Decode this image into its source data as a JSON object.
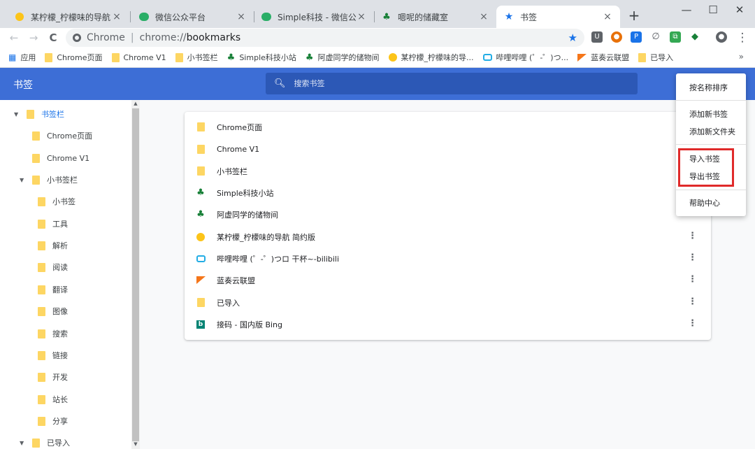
{
  "tabs": [
    {
      "title": "某柠檬_柠檬味的导航 简约",
      "close": "×",
      "icon": "lemon-icon"
    },
    {
      "title": "微信公众平台",
      "close": "×",
      "icon": "wechat-icon"
    },
    {
      "title": "Simple科技 - 微信公众平",
      "close": "×",
      "icon": "wechat-icon"
    },
    {
      "title": "嗯呢的储藏室",
      "close": "×",
      "icon": "tree-icon"
    },
    {
      "title": "书签",
      "close": "×",
      "icon": "star-icon"
    }
  ],
  "newtab": "+",
  "window": {
    "min": "—",
    "max": "☐",
    "close": "✕"
  },
  "toolbar": {
    "back": "←",
    "forward": "→",
    "reload": "C",
    "site": "Chrome",
    "url_scheme": "chrome://",
    "url_host": "bookmarks",
    "star": "★",
    "menu": "⋮"
  },
  "extensions": [
    {
      "icon": "pocket-icon",
      "glyph": "U",
      "color": "#5f6368"
    },
    {
      "icon": "monkey-icon",
      "glyph": "●",
      "color": "#e8710a"
    },
    {
      "icon": "p-icon",
      "glyph": "P",
      "color": "#1a73e8"
    },
    {
      "icon": "leaf-icon",
      "glyph": "∅",
      "color": "#5f6368"
    },
    {
      "icon": "screenshot-icon",
      "glyph": "⧉",
      "color": "#34a853"
    },
    {
      "icon": "globe-icon",
      "glyph": "◆",
      "color": "#188038"
    }
  ],
  "bookmarks_bar": {
    "apps": "应用",
    "items": [
      "Chrome页面",
      "Chrome V1",
      "小书签栏",
      "Simple科技小站",
      "阿虚同学的储物间",
      "某柠檬_柠檬味的导...",
      "哔哩哔哩 (゜-゜)つ...",
      "蓝奏云联盟",
      "已导入"
    ],
    "more": "»"
  },
  "header": {
    "title": "书签",
    "search_placeholder": "搜索书签"
  },
  "sidebar": {
    "items": [
      {
        "label": "书签栏",
        "level": 0,
        "expanded": true,
        "selected": true
      },
      {
        "label": "Chrome页面",
        "level": 1
      },
      {
        "label": "Chrome V1",
        "level": 1
      },
      {
        "label": "小书签栏",
        "level": 1,
        "expanded": true
      },
      {
        "label": "小书签",
        "level": 2
      },
      {
        "label": "工具",
        "level": 2
      },
      {
        "label": "解析",
        "level": 2
      },
      {
        "label": "阅读",
        "level": 2
      },
      {
        "label": "翻译",
        "level": 2
      },
      {
        "label": "图像",
        "level": 2
      },
      {
        "label": "搜索",
        "level": 2
      },
      {
        "label": "链接",
        "level": 2
      },
      {
        "label": "开发",
        "level": 2
      },
      {
        "label": "站长",
        "level": 2
      },
      {
        "label": "分享",
        "level": 2
      },
      {
        "label": "已导入",
        "level": 0,
        "expanded": true
      }
    ]
  },
  "list": [
    {
      "label": "Chrome页面",
      "icon": "folder-icon"
    },
    {
      "label": "Chrome V1",
      "icon": "folder-icon"
    },
    {
      "label": "小书签栏",
      "icon": "folder-icon"
    },
    {
      "label": "Simple科技小站",
      "icon": "tree-icon"
    },
    {
      "label": "阿虚同学的储物间",
      "icon": "tree-icon"
    },
    {
      "label": "某柠檬_柠檬味的导航 简约版",
      "icon": "lemon-icon"
    },
    {
      "label": "哔哩哔哩 (゜-゜)つロ 干杯~-bilibili",
      "icon": "bilibili-icon"
    },
    {
      "label": "蓝奏云联盟",
      "icon": "flag-icon"
    },
    {
      "label": "已导入",
      "icon": "folder-icon"
    },
    {
      "label": "接码 - 国内版 Bing",
      "icon": "bing-icon"
    }
  ],
  "menu": {
    "sort": "按名称排序",
    "add_bookmark": "添加新书签",
    "add_folder": "添加新文件夹",
    "import": "导入书签",
    "export": "导出书签",
    "help": "帮助中心"
  }
}
